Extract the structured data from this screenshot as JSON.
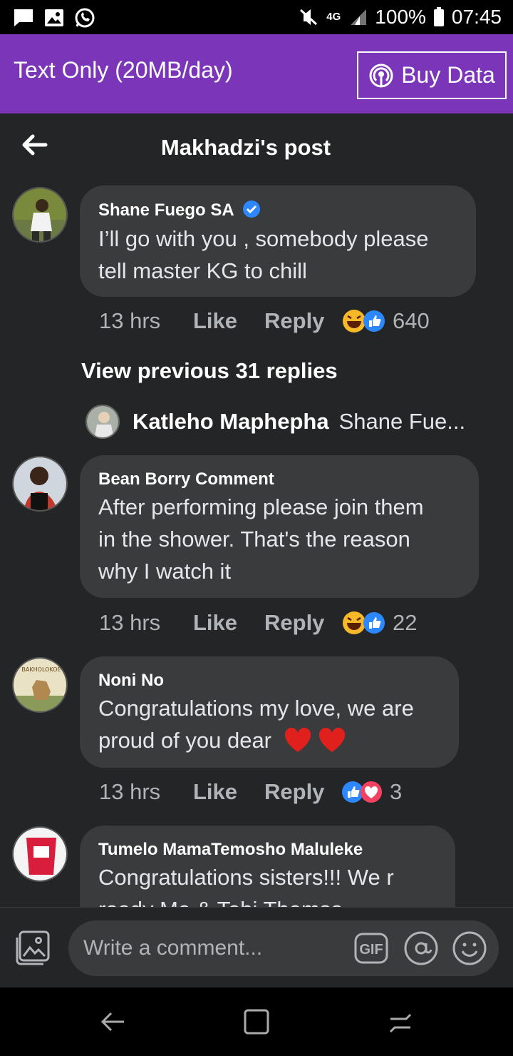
{
  "status_bar": {
    "signal_label": "4G",
    "battery": "100%",
    "time": "07:45",
    "icons": [
      "message-icon",
      "gallery-icon",
      "whatsapp-icon",
      "mute-icon",
      "signal-icon",
      "battery-icon"
    ]
  },
  "banner": {
    "text": "Text Only (20MB/day)",
    "button_label": "Buy Data",
    "color": "#7b35b8"
  },
  "header": {
    "title": "Makhadzi's post"
  },
  "comments": [
    {
      "author": "Shane Fuego SA",
      "verified": true,
      "lines": [
        "I’ll go with you , somebody please",
        "tell master KG to chill"
      ],
      "time": "13 hrs",
      "like": "Like",
      "reply": "Reply",
      "reactions": [
        "haha",
        "like"
      ],
      "count": "640"
    },
    {
      "author": "Bean Borry Comment",
      "verified": false,
      "lines": [
        "After performing please join them",
        "in the shower. That's the reason",
        "why I watch it"
      ],
      "time": "13 hrs",
      "like": "Like",
      "reply": "Reply",
      "reactions": [
        "haha",
        "like"
      ],
      "count": "22"
    },
    {
      "author": "Noni No",
      "verified": false,
      "lines": [
        "Congratulations my love, we are",
        "proud of you dear"
      ],
      "time": "13 hrs",
      "like": "Like",
      "reply": "Reply",
      "reactions": [
        "like",
        "care"
      ],
      "count": "3"
    },
    {
      "author": "Tumelo MamaTemosho Maluleke",
      "verified": false,
      "lines": [
        "Congratulations sisters!!! We r",
        "ready Me & Tebi Themsa"
      ],
      "time": "",
      "like": "",
      "reply": "",
      "reactions": [],
      "count": ""
    }
  ],
  "view_previous": "View previous 31 replies",
  "reply_preview": {
    "author": "Katleho Maphepha",
    "snippet": "Shane Fue..."
  },
  "composer": {
    "placeholder": "Write a comment...",
    "gif_label": "GIF"
  },
  "colors": {
    "background": "#242526",
    "bubble": "#3a3b3c",
    "verified": "#2d88ff"
  }
}
